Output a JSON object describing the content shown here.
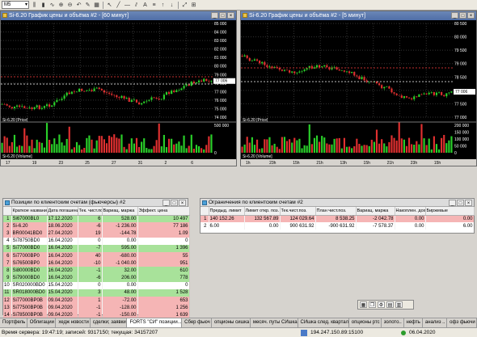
{
  "toolbar": {
    "timeframe": "M5"
  },
  "chart_left": {
    "title": "Si-6.20 График цены и объёма #2 - [60 минут]",
    "price_ticks": [
      "85 000",
      "84 000",
      "83 000",
      "82 000",
      "81 000",
      "80 000",
      "79 000",
      "78 000",
      "77 000",
      "76 000",
      "75 000",
      "74 000"
    ],
    "last_price": "77 006",
    "price_label": "Si-6.20 [Price]",
    "volume_label": "Si-6.20 [Volume]",
    "volume_ticks": [
      "500 000",
      "0"
    ],
    "date_ticks": [
      "17",
      "19",
      "23",
      "25",
      "27",
      "31",
      "2",
      "6"
    ],
    "month": "Apr"
  },
  "chart_right": {
    "title": "Si-6.20 График цены и объёма #2 - [5 минут]",
    "price_ticks": [
      "80 500",
      "80 000",
      "79 500",
      "79 000",
      "78 500",
      "78 000",
      "77 500",
      "77 000"
    ],
    "last_price": "77 006",
    "price_label": "Si-6.20 [Price]",
    "volume_label": "Si-6.20 [Volume]",
    "volume_ticks": [
      "200 000",
      "150 000",
      "100 000",
      "50 000",
      "0"
    ],
    "date_ticks": [
      "1h",
      "23h",
      "15h",
      "21h",
      "13h",
      "15h",
      "21h",
      "23h",
      "15h"
    ],
    "month": "Apr"
  },
  "positions": {
    "title": "Позиции по клиентским счетам (фьючерсы) #2",
    "headers": [
      "",
      "Краткое название",
      "Дата погашения",
      "Тек. чист.поз.",
      "Вариац. маржа",
      "Эффект. цена"
    ],
    "rows": [
      {
        "i": "1",
        "name": "Si67000BL0",
        "date": "17.12.2020",
        "pos": "6",
        "vm": "528.00",
        "price": "10 497",
        "color": "green"
      },
      {
        "i": "2",
        "name": "Si-6.20",
        "date": "18.06.2020",
        "pos": "-6",
        "vm": "-1 236.00",
        "price": "77 186",
        "color": "red"
      },
      {
        "i": "3",
        "name": "BR00041BD0",
        "date": "27.04.2020",
        "pos": "19",
        "vm": "-144.78",
        "price": "1.09",
        "color": "red"
      },
      {
        "i": "4",
        "name": "Si78750BD0",
        "date": "16.04.2020",
        "pos": "0",
        "vm": "0.00",
        "price": "0",
        "color": "white"
      },
      {
        "i": "5",
        "name": "Si77000BD0",
        "date": "16.04.2020",
        "pos": "-7",
        "vm": "595.00",
        "price": "1 396",
        "color": "green"
      },
      {
        "i": "6",
        "name": "Si77000BP0",
        "date": "16.04.2020",
        "pos": "40",
        "vm": "-680.00",
        "price": "55",
        "color": "red"
      },
      {
        "i": "7",
        "name": "Si76500BP0",
        "date": "16.04.2020",
        "pos": "-10",
        "vm": "-1 040.00",
        "price": "951",
        "color": "red"
      },
      {
        "i": "8",
        "name": "Si80000BD0",
        "date": "16.04.2020",
        "pos": "-1",
        "vm": "32.00",
        "price": "610",
        "color": "green"
      },
      {
        "i": "9",
        "name": "Si79000BD0",
        "date": "16.04.2020",
        "pos": "-6",
        "vm": "206.00",
        "price": "778",
        "color": "green"
      },
      {
        "i": "10",
        "name": "SR020000BD0",
        "date": "15.04.2020",
        "pos": "0",
        "vm": "0.00",
        "price": "0",
        "color": "white"
      },
      {
        "i": "11",
        "name": "SR018000BD0",
        "date": "15.04.2020",
        "pos": "3",
        "vm": "48.00",
        "price": "1 528",
        "color": "green"
      },
      {
        "i": "12",
        "name": "Si77000BP0B",
        "date": "09.04.2020",
        "pos": "1",
        "vm": "-72.00",
        "price": "653",
        "color": "red"
      },
      {
        "i": "13",
        "name": "Si77500BP0B",
        "date": "09.04.2020",
        "pos": "-1",
        "vm": "-128.00",
        "price": "1 256",
        "color": "red"
      },
      {
        "i": "14",
        "name": "Si78500BP0B",
        "date": "09.04.2020",
        "pos": "-1",
        "vm": "-150.00",
        "price": "1 639",
        "color": "red"
      }
    ]
  },
  "limits": {
    "title": "Ограничения по клиентским счетам #2",
    "headers": [
      "",
      "Предыд. лимит",
      "Лимит откр. поз.",
      "Тек.чист.поз.",
      "План чист.поз.",
      "Вариац. маржа",
      "Накоплен. доход",
      "Биржевые"
    ],
    "rows": [
      {
        "i": "1",
        "prev": "140 152.26",
        "open": "132 567.89",
        "cur": "124 029.64",
        "plan": "8 538.25",
        "vm": "-2 042.78",
        "acc": "0.00",
        "fee": "0.00",
        "color": "red"
      },
      {
        "i": "2",
        "prev": "6.00",
        "open": "0.00",
        "cur": "900 631.92",
        "plan": "-900 631.92",
        "vm": "-7 578.37",
        "acc": "0.00",
        "fee": "6.00",
        "color": "white"
      }
    ]
  },
  "tabs": [
    "Портфель",
    "Облигации",
    "хедж новости",
    "сделки; заявки",
    "FORTS \"СИ\" позиции...",
    "Сбер фьюч",
    "опционы сишка",
    "месяч. путы СИшка",
    "СИшка след. квартал",
    "опционы ртс",
    "золото..",
    "нефть",
    "анализ ..",
    "офз фьючи"
  ],
  "status": {
    "server": "Время сервера: 19:47:19; записей: 9317150; текущая: 34157207",
    "ip": "194.247.150.89:15100",
    "date": "06.04.2020"
  },
  "colors": {
    "up": "#2ad02a",
    "down": "#e03030",
    "chart_bg": "#000000",
    "title_bar": "#5a78ae"
  }
}
